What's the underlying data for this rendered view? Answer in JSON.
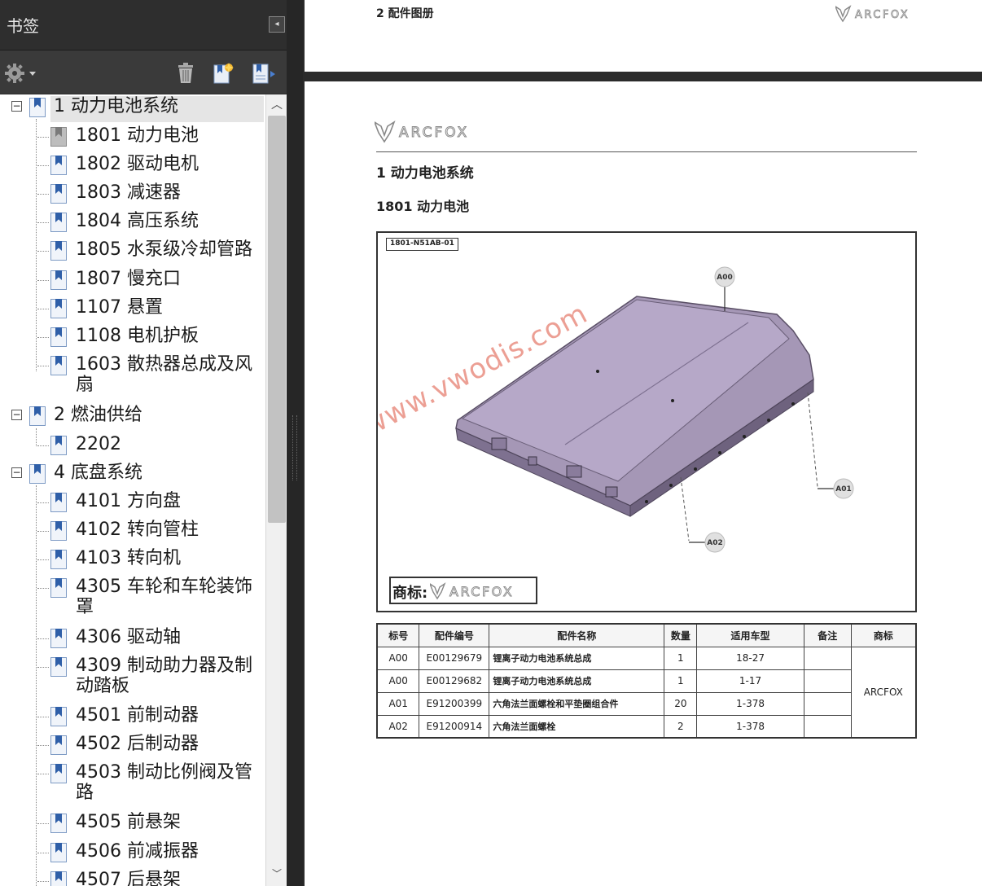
{
  "bookmarks_panel": {
    "title": "书签",
    "icons": {
      "options": "gear-icon",
      "delete": "trash-icon",
      "new_bookmark": "new-bookmark-icon",
      "expand": "expand-bookmark-icon"
    },
    "tree": [
      {
        "label": "1 动力电池系统",
        "level": 0,
        "expanded": true,
        "selected": true
      },
      {
        "label": "1801 动力电池",
        "level": 1,
        "gray": true
      },
      {
        "label": "1802 驱动电机",
        "level": 1
      },
      {
        "label": "1803 减速器",
        "level": 1
      },
      {
        "label": "1804 高压系统",
        "level": 1
      },
      {
        "label": "1805 水泵级冷却管路",
        "level": 1
      },
      {
        "label": "1807 慢充口",
        "level": 1
      },
      {
        "label": "1107 悬置",
        "level": 1
      },
      {
        "label": "1108 电机护板",
        "level": 1
      },
      {
        "label": "1603 散热器总成及风扇",
        "level": 1
      },
      {
        "label": "2 燃油供给",
        "level": 0,
        "expanded": true
      },
      {
        "label": "2202",
        "level": 1
      },
      {
        "label": "4 底盘系统",
        "level": 0,
        "expanded": true
      },
      {
        "label": "4101 方向盘",
        "level": 1
      },
      {
        "label": "4102 转向管柱",
        "level": 1
      },
      {
        "label": "4103 转向机",
        "level": 1
      },
      {
        "label": "4305 车轮和车轮装饰罩",
        "level": 1
      },
      {
        "label": "4306 驱动轴",
        "level": 1
      },
      {
        "label": "4309 制动助力器及制动踏板",
        "level": 1
      },
      {
        "label": "4501 前制动器",
        "level": 1
      },
      {
        "label": "4502 后制动器",
        "level": 1
      },
      {
        "label": "4503 制动比例阀及管路",
        "level": 1
      },
      {
        "label": "4505 前悬架",
        "level": 1
      },
      {
        "label": "4506 前减振器",
        "level": 1
      },
      {
        "label": "4507 后悬架",
        "level": 1
      }
    ]
  },
  "previous_page": {
    "chapter": "2 配件图册",
    "brand": "ARCFOX"
  },
  "page": {
    "brand": "ARCFOX",
    "heading1": "1 动力电池系统",
    "heading2": "1801 动力电池",
    "figure": {
      "id": "1801-N51AB-01",
      "callouts": [
        "A00",
        "A01",
        "A02"
      ],
      "brand_label": "商标:",
      "brand_logo": "ARCFOX",
      "watermark": "www.vwodis.com"
    },
    "table": {
      "headers": [
        "标号",
        "配件编号",
        "配件名称",
        "数量",
        "适用车型",
        "备注",
        "商标"
      ],
      "rows": [
        [
          "A00",
          "E00129679",
          "锂离子动力电池系统总成",
          "1",
          "18-27",
          ""
        ],
        [
          "A00",
          "E00129682",
          "锂离子动力电池系统总成",
          "1",
          "1-17",
          ""
        ],
        [
          "A01",
          "E91200399",
          "六角法兰面螺栓和平垫圈组合件",
          "20",
          "1-378",
          ""
        ],
        [
          "A02",
          "E91200914",
          "六角法兰面螺栓",
          "2",
          "1-378",
          ""
        ]
      ],
      "brand": "ARCFOX"
    }
  }
}
